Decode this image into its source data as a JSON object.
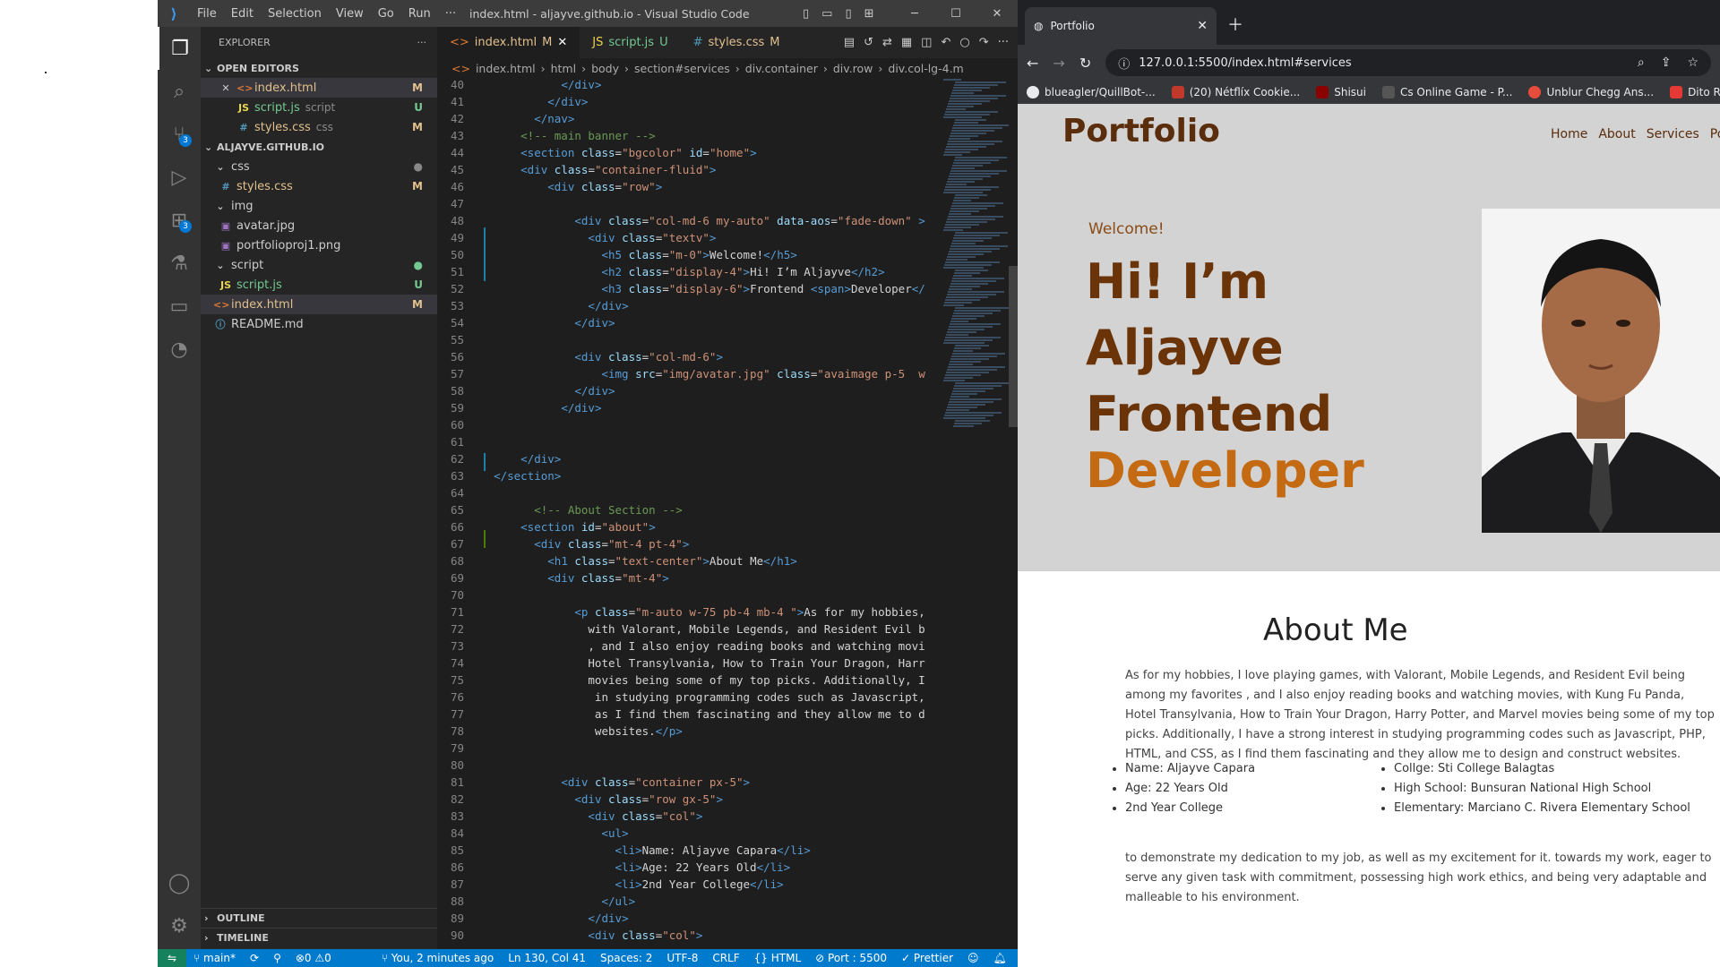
{
  "vscode": {
    "menu": [
      "File",
      "Edit",
      "Selection",
      "View",
      "Go",
      "Run",
      "···"
    ],
    "title": "index.html - aljayve.github.io - Visual Studio Code",
    "explorer_title": "EXPLORER",
    "open_editors_label": "OPEN EDITORS",
    "open_editors": [
      {
        "name": "index.html",
        "status": "M",
        "kind": "html"
      },
      {
        "name": "script.js",
        "sub": "script",
        "status": "U",
        "kind": "js"
      },
      {
        "name": "styles.css",
        "sub": "css",
        "status": "M",
        "kind": "css"
      }
    ],
    "workspace_label": "ALJAYVE.GITHUB.IO",
    "tree": [
      {
        "name": "css",
        "type": "folder",
        "depth": 1
      },
      {
        "name": "styles.css",
        "type": "css",
        "depth": 2,
        "status": "M"
      },
      {
        "name": "img",
        "type": "folder",
        "depth": 1
      },
      {
        "name": "avatar.jpg",
        "type": "img",
        "depth": 2
      },
      {
        "name": "portfolioproj1.png",
        "type": "img",
        "depth": 2
      },
      {
        "name": "script",
        "type": "folder",
        "depth": 1
      },
      {
        "name": "script.js",
        "type": "js",
        "depth": 2,
        "status": "U"
      },
      {
        "name": "index.html",
        "type": "html",
        "depth": 1,
        "status": "M"
      },
      {
        "name": "README.md",
        "type": "info",
        "depth": 1
      }
    ],
    "outline_label": "OUTLINE",
    "timeline_label": "TIMELINE",
    "tabs": [
      {
        "label": "index.html",
        "status": "M",
        "kind": "html"
      },
      {
        "label": "script.js",
        "status": "U",
        "kind": "js"
      },
      {
        "label": "styles.css",
        "status": "M",
        "kind": "css"
      }
    ],
    "breadcrumbs": [
      "index.html",
      "html",
      "body",
      "section#services",
      "div.container",
      "div.row",
      "div.col-lg-4.m"
    ],
    "code_lines": [
      {
        "n": "40",
        "text": "            </div>"
      },
      {
        "n": "41",
        "text": "          </div>"
      },
      {
        "n": "42",
        "text": "        </nav>"
      },
      {
        "n": "43",
        "text": "      <!-- main banner -->"
      },
      {
        "n": "44",
        "text": "      <section class=\"bgcolor\" id=\"home\">"
      },
      {
        "n": "45",
        "text": "      <div class=\"container-fluid\">"
      },
      {
        "n": "46",
        "text": "          <div class=\"row\">"
      },
      {
        "n": "47",
        "text": ""
      },
      {
        "n": "48",
        "text": "              <div class=\"col-md-6 my-auto\" data-aos=\"fade-down\" >"
      },
      {
        "n": "49",
        "text": "                <div class=\"textv\">"
      },
      {
        "n": "50",
        "text": "                  <h5 class=\"m-0\">Welcome!</h5>"
      },
      {
        "n": "51",
        "text": "                  <h2 class=\"display-4\">Hi! I’m Aljayve</h2>"
      },
      {
        "n": "52",
        "text": "                  <h3 class=\"display-6\">Frontend <span>Developer</"
      },
      {
        "n": "53",
        "text": "                </div>"
      },
      {
        "n": "54",
        "text": "              </div>"
      },
      {
        "n": "55",
        "text": ""
      },
      {
        "n": "56",
        "text": "              <div class=\"col-md-6\">"
      },
      {
        "n": "57",
        "text": "                  <img src=\"img/avatar.jpg\" class=\"avaimage p-5  w"
      },
      {
        "n": "58",
        "text": "              </div>"
      },
      {
        "n": "59",
        "text": "            </div>"
      },
      {
        "n": "60",
        "text": ""
      },
      {
        "n": "61",
        "text": ""
      },
      {
        "n": "62",
        "text": "      </div>"
      },
      {
        "n": "63",
        "text": "  </section>"
      },
      {
        "n": "64",
        "text": ""
      },
      {
        "n": "65",
        "text": "        <!-- About Section -->"
      },
      {
        "n": "66",
        "text": "      <section id=\"about\">"
      },
      {
        "n": "67",
        "text": "        <div class=\"mt-4 pt-4\">"
      },
      {
        "n": "68",
        "text": "          <h1 class=\"text-center\">About Me</h1>"
      },
      {
        "n": "69",
        "text": "          <div class=\"mt-4\">"
      },
      {
        "n": "70",
        "text": ""
      },
      {
        "n": "71",
        "text": "              <p class=\"m-auto w-75 pb-4 mb-4 \">As for my hobbies,"
      },
      {
        "n": "72",
        "text": "                with Valorant, Mobile Legends, and Resident Evil b"
      },
      {
        "n": "73",
        "text": "                , and I also enjoy reading books and watching movi"
      },
      {
        "n": "74",
        "text": "                Hotel Transylvania, How to Train Your Dragon, Harr"
      },
      {
        "n": "75",
        "text": "                movies being some of my top picks. Additionally, I"
      },
      {
        "n": "76",
        "text": "                 in studying programming codes such as Javascript,"
      },
      {
        "n": "77",
        "text": "                 as I find them fascinating and they allow me to d"
      },
      {
        "n": "78",
        "text": "                 websites.</p>"
      },
      {
        "n": "79",
        "text": ""
      },
      {
        "n": "80",
        "text": ""
      },
      {
        "n": "81",
        "text": "            <div class=\"container px-5\">"
      },
      {
        "n": "82",
        "text": "              <div class=\"row gx-5\">"
      },
      {
        "n": "83",
        "text": "                <div class=\"col\">"
      },
      {
        "n": "84",
        "text": "                  <ul>"
      },
      {
        "n": "85",
        "text": "                    <li>Name: Aljayve Capara</li>"
      },
      {
        "n": "86",
        "text": "                    <li>Age: 22 Years Old</li>"
      },
      {
        "n": "87",
        "text": "                    <li>2nd Year College</li>"
      },
      {
        "n": "88",
        "text": "                  </ul>"
      },
      {
        "n": "89",
        "text": "                </div>"
      },
      {
        "n": "90",
        "text": "                <div class=\"col\">"
      }
    ],
    "status": {
      "branch": "main*",
      "errors": "⊗0 ⚠0",
      "blame": "You, 2 minutes ago",
      "position": "Ln 130, Col 41",
      "spaces": "Spaces: 2",
      "encoding": "UTF-8",
      "eol": "CRLF",
      "language": "HTML",
      "port": "Port : 5500",
      "prettier": "Prettier"
    }
  },
  "browser": {
    "tab_title": "Portfolio",
    "url": "127.0.0.1:5500/index.html#services",
    "bookmarks": [
      {
        "label": "blueagler/QuillBot-...",
        "color": "#e8eaed"
      },
      {
        "label": "(20) Nétflíx Cookie...",
        "color": "#c0392b"
      },
      {
        "label": "Shisui",
        "color": "#8b0000"
      },
      {
        "label": "Cs Online Game - P...",
        "color": "#555555"
      },
      {
        "label": "Unblur Chegg Ans...",
        "color": "#e74c3c"
      },
      {
        "label": "Dito Register",
        "color": "#e53935"
      }
    ],
    "site": {
      "brand": "Portfolio",
      "nav": [
        "Home",
        "About",
        "Services",
        "Po"
      ],
      "welcome": "Welcome!",
      "heading": "Hi! I’m Aljayve",
      "role": "Frontend",
      "role_accent": "Developer",
      "about_title": "About Me",
      "about_text": "As for my hobbies, I love playing games, with Valorant, Mobile Legends, and Resident Evil being among my favorites , and I also enjoy reading books and watching movies, with Kung Fu Panda, Hotel Transylvania, How to Train Your Dragon, Harry Potter, and Marvel movies being some of my top picks. Additionally, I have a strong interest in studying programming codes such as Javascript, PHP, HTML, and CSS, as I find them fascinating and they allow me to design and construct websites.",
      "list_left": [
        "Name: Aljayve Capara",
        "Age: 22 Years Old",
        "2nd Year College"
      ],
      "list_right": [
        "Collge: Sti College Balagtas",
        "High School: Bunsuran National High School",
        "Elementary: Marciano C. Rivera Elementary School"
      ],
      "closing_text": "to demonstrate my dedication to my job, as well as my excitement for it. towards my work, eager to serve any given task with commitment, possessing high work ethics, and being very adaptable and malleable to his environment."
    }
  }
}
